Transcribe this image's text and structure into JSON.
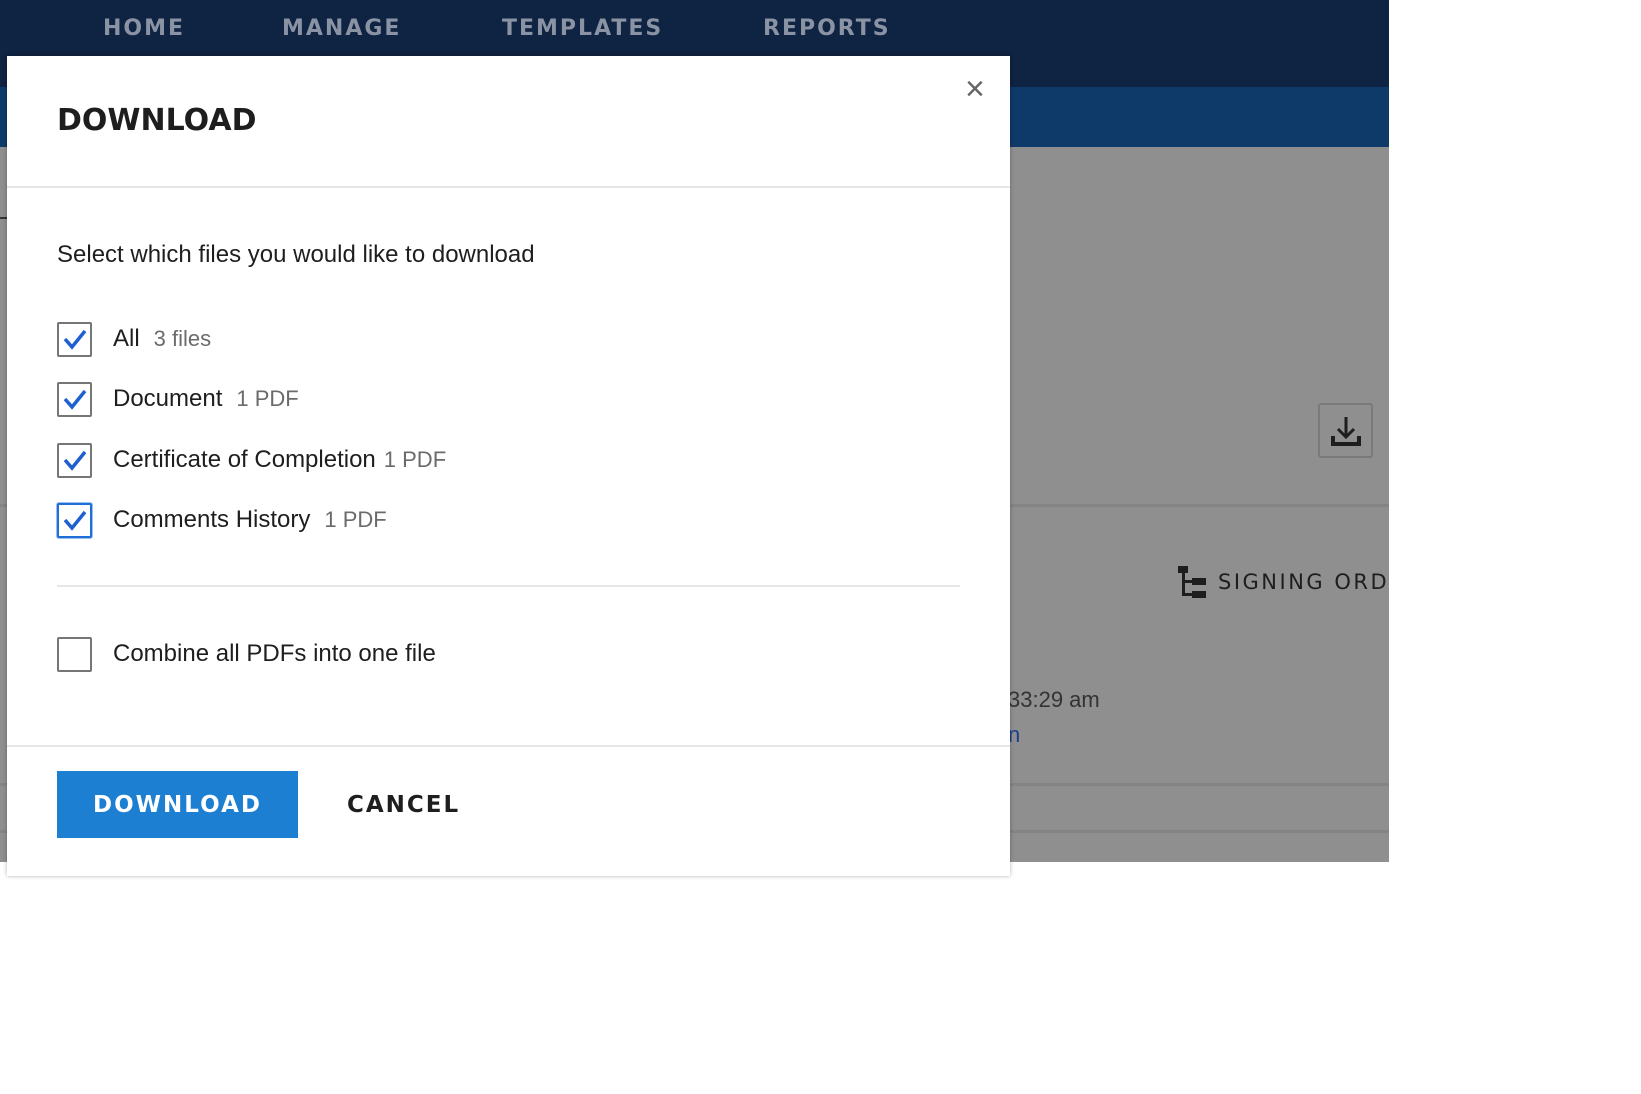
{
  "nav": {
    "items": [
      "HOME",
      "MANAGE",
      "TEMPLATES",
      "REPORTS"
    ]
  },
  "background": {
    "signing_order": "SIGNING ORD",
    "time": "33:29 am",
    "link_fragment": "n"
  },
  "modal": {
    "title": "DOWNLOAD",
    "subtitle": "Select which files you would like to download",
    "options": [
      {
        "label": "All",
        "meta": "3 files",
        "checked": true
      },
      {
        "label": "Document",
        "meta": "1 PDF",
        "checked": true
      },
      {
        "label": "Certificate of Completion",
        "meta": "1 PDF",
        "checked": true
      },
      {
        "label": "Comments History",
        "meta": "1 PDF",
        "checked": true
      }
    ],
    "combine": {
      "label": "Combine all PDFs into one file",
      "checked": false
    },
    "download_label": "DOWNLOAD",
    "cancel_label": "CANCEL"
  },
  "colors": {
    "primary": "#1c7fd1",
    "nav": "#0f2342",
    "check": "#1f5fd0"
  }
}
